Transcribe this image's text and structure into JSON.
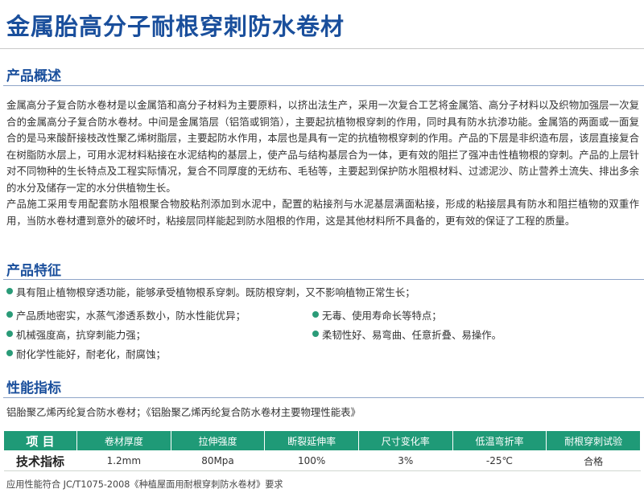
{
  "title": "金属胎高分子耐根穿刺防水卷材",
  "overview": {
    "heading": "产品概述",
    "paragraphs": [
      "金属高分子复合防水卷材是以金属箔和高分子材料为主要原料，以挤出法生产，采用一次复合工艺将金属箔、高分子材料以及织物加强层一次复合的金属高分子复合防水卷材。中间是金属箔层（铝箔或铜箔），主要起抗植物根穿刺的作用，同时具有防水抗渗功能。金属箔的两面或一面复合的是马来酸酐接枝改性聚乙烯树脂层，主要起防水作用，本层也是具有一定的抗植物根穿刺的作用。产品的下层是非织造布层，该层直接复合在树脂防水层上，可用水泥材料粘接在水泥结构的基层上，使产品与结构基层合为一体，更有效的阻拦了强冲击性植物根的穿刺。产品的上层针对不同物种的生长特点及工程实际情况，复合不同厚度的无纺布、毛毡等，主要起到保护防水阻根材料、过滤泥沙、防止营养土流失、排出多余的水分及储存一定的水分供植物生长。",
      "产品施工采用专用配套防水阻根聚合物胶粘剂添加到水泥中，配置的粘接剂与水泥基层满面粘接，形成的粘接层具有防水和阻拦植物的双重作用，当防水卷材遭到意外的破坏时，粘接层同样能起到防水阻根的作用，这是其他材料所不具备的，更有效的保证了工程的质量。"
    ]
  },
  "features": {
    "heading": "产品特征",
    "items": [
      "具有阻止植物根穿透功能，能够承受植物根系穿刺。既防根穿刺，又不影响植物正常生长；",
      "产品质地密实，水蒸气渗透系数小，防水性能优异；",
      "无毒、使用寿命长等特点；",
      "机械强度高，抗穿刺能力强；",
      "柔韧性好、易弯曲、任意折叠、易操作。",
      "耐化学性能好，耐老化，耐腐蚀；"
    ]
  },
  "performance": {
    "heading": "性能指标",
    "description": "铝胎聚乙烯丙纶复合防水卷材；《铝胎聚乙烯丙纶复合防水卷材主要物理性能表》",
    "headers": [
      "项 目",
      "卷材厚度",
      "拉伸强度",
      "断裂延伸率",
      "尺寸变化率",
      "低温弯折率",
      "耐根穿刺试验"
    ],
    "row": [
      "技术指标",
      "1.2mm",
      "80Mpa",
      "100%",
      "3%",
      "-25℃",
      "合格"
    ],
    "footnote": "应用性能符合 JC/T1075-2008《种植屋面用耐根穿刺防水卷材》要求"
  },
  "colors": {
    "title_blue": "#1a4f9c",
    "table_header_green": "#1f9a77",
    "bullet_green": "#2a9b78"
  }
}
